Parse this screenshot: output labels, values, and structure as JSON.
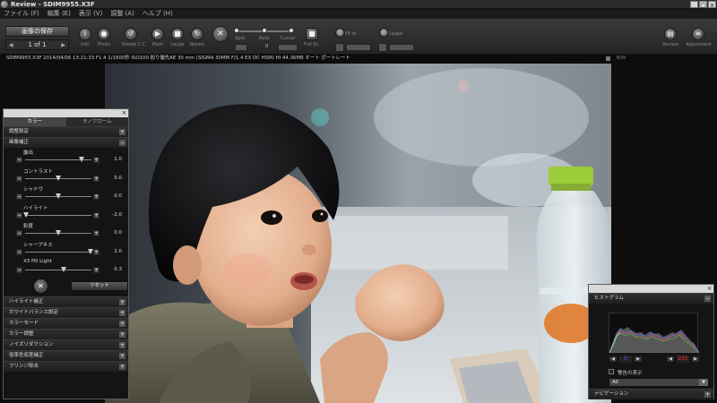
{
  "window": {
    "title": "Review - SDIM9955.X3F",
    "minimize": "_",
    "maximize": "□",
    "close": "×"
  },
  "menu": {
    "items": [
      "ファイル (F)",
      "編集 (E)",
      "表示 (V)",
      "調整 (A)",
      "ヘルプ (H)"
    ]
  },
  "toolbar": {
    "save_label": "画像の保存",
    "page_indicator": "1 of 1",
    "page_prev": "◀",
    "page_next": "▶",
    "tools": [
      {
        "label": "Info",
        "icon": "info-icon",
        "glyph": "i"
      },
      {
        "label": "Photo",
        "icon": "camera-icon",
        "glyph": "●"
      },
      {
        "label": "Rotate C.C.",
        "icon": "rotate-ccw-icon",
        "glyph": "↺"
      },
      {
        "label": "Mark",
        "icon": "mark-icon",
        "glyph": "▶"
      },
      {
        "label": "Loupe",
        "icon": "lock-icon",
        "glyph": "■"
      },
      {
        "label": "Rotate",
        "icon": "rotate-cw-icon",
        "glyph": "↻"
      },
      {
        "label": "",
        "icon": "wand-icon",
        "glyph": "✕"
      },
      {
        "label": "Full Sc.",
        "icon": "fullscreen-icon",
        "glyph": "■"
      },
      {
        "label": "Fit to",
        "icon": "fit-to-icon",
        "glyph": "◎"
      },
      {
        "label": "Loupe",
        "icon": "loupe-icon",
        "glyph": "◎"
      },
      {
        "label": "Review",
        "icon": "review-icon",
        "glyph": "▤"
      },
      {
        "label": "Adjustment",
        "icon": "adjustment-icon",
        "glyph": "≡"
      }
    ],
    "zoom_labels": [
      "Spot",
      "Auto",
      "Cursor"
    ],
    "zoom_value": "0"
  },
  "info_bar": {
    "text": "SDIM9955.X3F  2014/04/06 13:21:33  F1.4  1/1600秒  ISO100  絞り優先AE  30 mm  (SIGMA 30MM F/1.4 EX DC HSM)  HI  44.36MB  オート  ポートレート",
    "right_label": "B/W"
  },
  "adjust_panel": {
    "tabs": [
      "カラー",
      "モノクローム"
    ],
    "active_tab": 0,
    "top_sections": [
      {
        "label": "調整設定",
        "toggle": "+"
      },
      {
        "label": "画像補正",
        "toggle": "−"
      }
    ],
    "sliders": [
      {
        "label": "露出",
        "value": "1.0",
        "pos": 0.85
      },
      {
        "label": "コントラスト",
        "value": "0.0",
        "pos": 0.5
      },
      {
        "label": "シャドウ",
        "value": "0.0",
        "pos": 0.5
      },
      {
        "label": "ハイライト",
        "value": "-2.0",
        "pos": 0.02
      },
      {
        "label": "彩度",
        "value": "0.0",
        "pos": 0.5
      },
      {
        "label": "シャープネス",
        "value": "2.0",
        "pos": 0.98
      },
      {
        "label": "X3 Fill Light",
        "value": "0.3",
        "pos": 0.58
      }
    ],
    "reset_label": "リセット",
    "bottom_sections": [
      {
        "label": "ハイライト補正",
        "toggle": "+"
      },
      {
        "label": "ホワイトバランス設定",
        "toggle": "+"
      },
      {
        "label": "カラーモード",
        "toggle": "+"
      },
      {
        "label": "カラー調整",
        "toggle": "+"
      },
      {
        "label": "ノイズリダクション",
        "toggle": "+"
      },
      {
        "label": "倍率色収差補正",
        "toggle": "+"
      },
      {
        "label": "フリンジ除去",
        "toggle": "+"
      }
    ]
  },
  "histogram_panel": {
    "title": "ヒストグラム",
    "toggle": "−",
    "low_value": "0",
    "high_value": "255",
    "warning_label": "警告の表示",
    "channel": "All",
    "navigation_label": "ナビゲーション",
    "navigation_toggle": "+"
  },
  "colors": {
    "accent_blue": "#3f5fff",
    "high_red": "#ff3030"
  }
}
